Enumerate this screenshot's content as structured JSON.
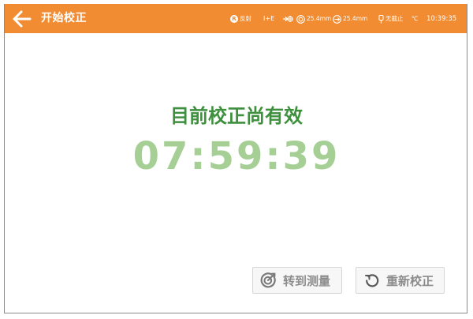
{
  "header": {
    "title": "开始校正",
    "back_icon": "arrow-left-icon",
    "background_color": "#f28c33"
  },
  "status_bar": {
    "mode_badge": "R",
    "mode_label": "反射",
    "format_label": "I+E",
    "ring_value": "25.4mm",
    "diameter_value": "25.4mm",
    "probe_label": "无截止",
    "temperature_unit": "℃",
    "time": "10:39:35"
  },
  "main": {
    "message": "目前校正尚有效",
    "countdown": "07:59:39",
    "message_color": "#3e8f3e",
    "countdown_color": "#a5cf95"
  },
  "buttons": {
    "measure_label": "转到测量",
    "recalibrate_label": "重新校正"
  }
}
